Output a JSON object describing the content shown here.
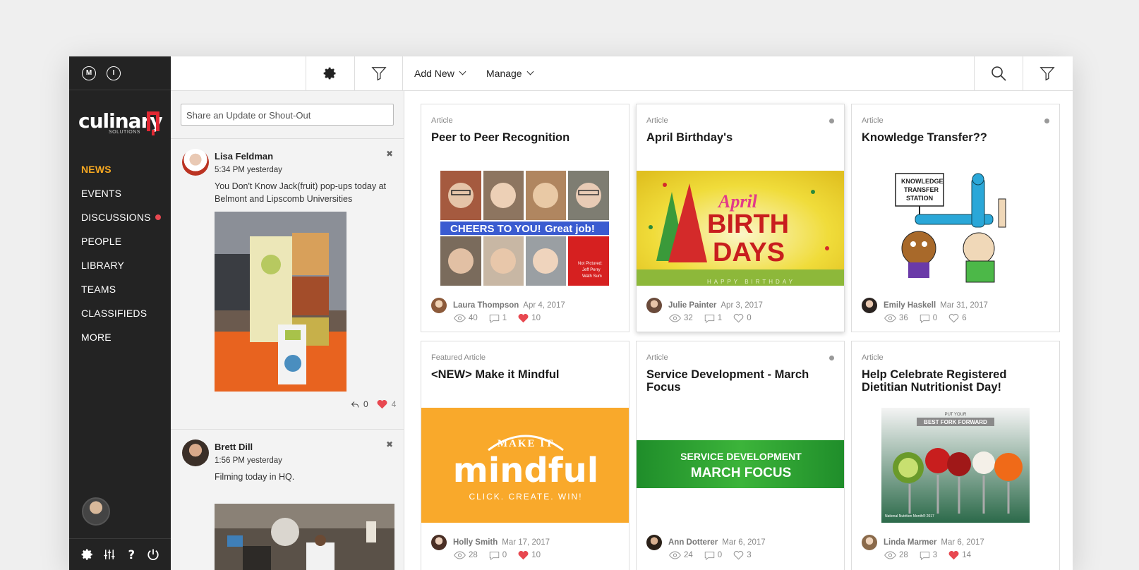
{
  "sidebar": {
    "top_icons": [
      "M",
      "I"
    ],
    "logo": {
      "word": "culinary",
      "sub": "SOLUTIONS"
    },
    "nav": [
      {
        "label": "NEWS",
        "active": true
      },
      {
        "label": "EVENTS"
      },
      {
        "label": "DISCUSSIONS",
        "badge": true
      },
      {
        "label": "PEOPLE"
      },
      {
        "label": "LIBRARY"
      },
      {
        "label": "TEAMS"
      },
      {
        "label": "CLASSIFIEDS"
      },
      {
        "label": "MORE"
      }
    ],
    "bottom_icons": [
      "gear-icon",
      "sliders-icon",
      "help-icon",
      "power-icon"
    ]
  },
  "topbar": {
    "add_new": "Add New",
    "manage": "Manage"
  },
  "feed": {
    "share_placeholder": "Share an Update or Shout-Out",
    "posts": [
      {
        "name": "Lisa Feldman",
        "time": "5:34 PM yesterday",
        "text": "You Don't Know Jack(fruit) pop-ups today at Belmont and Lipscomb Universities",
        "replies": "0",
        "likes": "4"
      },
      {
        "name": "Brett Dill",
        "time": "1:56 PM yesterday",
        "text": "Filming today in HQ."
      }
    ]
  },
  "cards": [
    {
      "type": "Article",
      "title": "Peer to Peer Recognition",
      "author": "Laura Thompson",
      "date": "Apr 4, 2017",
      "views": "40",
      "comments": "1",
      "likes": "10",
      "liked": true,
      "dot": false,
      "image_text": [
        "CHEERS TO YOU!",
        "Great job!",
        "Not Pictured:",
        "Jeff Perry",
        "Wath Sum"
      ]
    },
    {
      "type": "Article",
      "title": "April Birthday's",
      "author": "Julie Painter",
      "date": "Apr 3, 2017",
      "views": "32",
      "comments": "1",
      "likes": "0",
      "liked": false,
      "dot": true,
      "image_text": [
        "April",
        "BIRTH",
        "DAYS",
        "HAPPY BIRTHDAY"
      ]
    },
    {
      "type": "Article",
      "title": "Knowledge Transfer??",
      "author": "Emily Haskell",
      "date": "Mar 31, 2017",
      "views": "36",
      "comments": "0",
      "likes": "6",
      "liked": false,
      "dot": true,
      "image_text": [
        "KNOWLEDGE",
        "TRANSFER",
        "STATION"
      ]
    },
    {
      "type": "Featured Article",
      "title": "<NEW> Make it Mindful",
      "author": "Holly Smith",
      "date": "Mar 17, 2017",
      "views": "28",
      "comments": "0",
      "likes": "10",
      "liked": true,
      "dot": false,
      "image_text": [
        "MAKE IT",
        "mindful",
        "CLICK. CREATE. WIN!"
      ]
    },
    {
      "type": "Article",
      "title": "Service Development - March Focus",
      "author": "Ann Dotterer",
      "date": "Mar 6, 2017",
      "views": "24",
      "comments": "0",
      "likes": "3",
      "liked": false,
      "dot": true,
      "image_text": [
        "SERVICE DEVELOPMENT",
        "MARCH FOCUS"
      ]
    },
    {
      "type": "Article",
      "title": "Help Celebrate Registered Dietitian Nutritionist Day!",
      "author": "Linda Marmer",
      "date": "Mar 6, 2017",
      "views": "28",
      "comments": "3",
      "likes": "14",
      "liked": true,
      "dot": false,
      "image_text": [
        "PUT YOUR",
        "BEST FORK FORWARD",
        "National Nutrition Month® 2017"
      ]
    }
  ],
  "colors": {
    "accent": "#f6a821",
    "like": "#e84850",
    "sidebar": "#232323"
  }
}
